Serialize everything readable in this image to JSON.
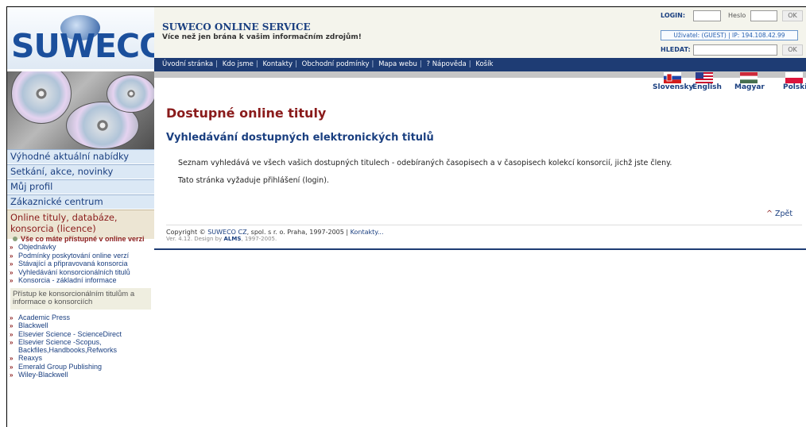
{
  "logo": {
    "text": "SUWECO"
  },
  "header": {
    "brand": "SUWECO ONLINE SERVICE",
    "tagline": "Více než jen brána k vašim informačním zdrojům!",
    "login_label": "LOGIN:",
    "heslo_label": "Heslo",
    "ok_label": "OK",
    "user_info": "Uživatel: (GUEST) | IP: 194.108.42.99",
    "search_label": "HLEDAT:",
    "search_ok": "OK"
  },
  "topnav": {
    "links": [
      "Úvodní stránka",
      "Kdo jsme",
      "Kontakty",
      "Obchodní podmínky",
      "Mapa webu",
      "? Nápověda",
      "Košík"
    ]
  },
  "languages": [
    "Slovensky",
    "English",
    "Magyar",
    "Polski"
  ],
  "sidebar": {
    "items": [
      "Výhodné aktuální nabídky",
      "Setkání, akce, novinky",
      "Můj profil",
      "Zákaznické centrum",
      "Online tituly, databáze, konsorcia (licence)"
    ],
    "sub_lead": "Vše co máte přístupné v online verzi",
    "sub_items": [
      "Objednávky",
      "Podmínky poskytování online verzí",
      "Stávající a připravovaná konsorcia",
      "Vyhledávání konsorcionálních titulů",
      "Konsorcia - základní informace"
    ],
    "box_text": "Přístup ke konsorcionálním titulům a informace o konsorciích",
    "publishers": [
      "Academic Press",
      "Blackwell",
      "Elsevier Science - ScienceDirect",
      "Elsevier Science -Scopus, Backfiles,Handbooks,Refworks",
      "Reaxys",
      "Emerald Group Publishing",
      "Wiley-Blackwell"
    ]
  },
  "main": {
    "title": "Dostupné online tituly",
    "subtitle": "Vyhledávání dostupných elektronických titulů",
    "paragraph1": "Seznam vyhledává ve všech vašich dostupných titulech - odebíraných časopisech a v časopisech kolekcí konsorcií, jichž jste členy.",
    "paragraph2": "Tato stránka vyžaduje přihlášení (login).",
    "back": "Zpět",
    "back_caret": "^",
    "copyright_prefix": "Copyright ©",
    "copyright_company": "SUWECO CZ",
    "copyright_rest": ", spol. s r. o. Praha, 1997-2005 |",
    "copyright_link": "Kontakty...",
    "version_prefix": "Ver. 4.12. Design by",
    "version_link": "ALMS",
    "version_suffix": ", 1997-2005."
  }
}
